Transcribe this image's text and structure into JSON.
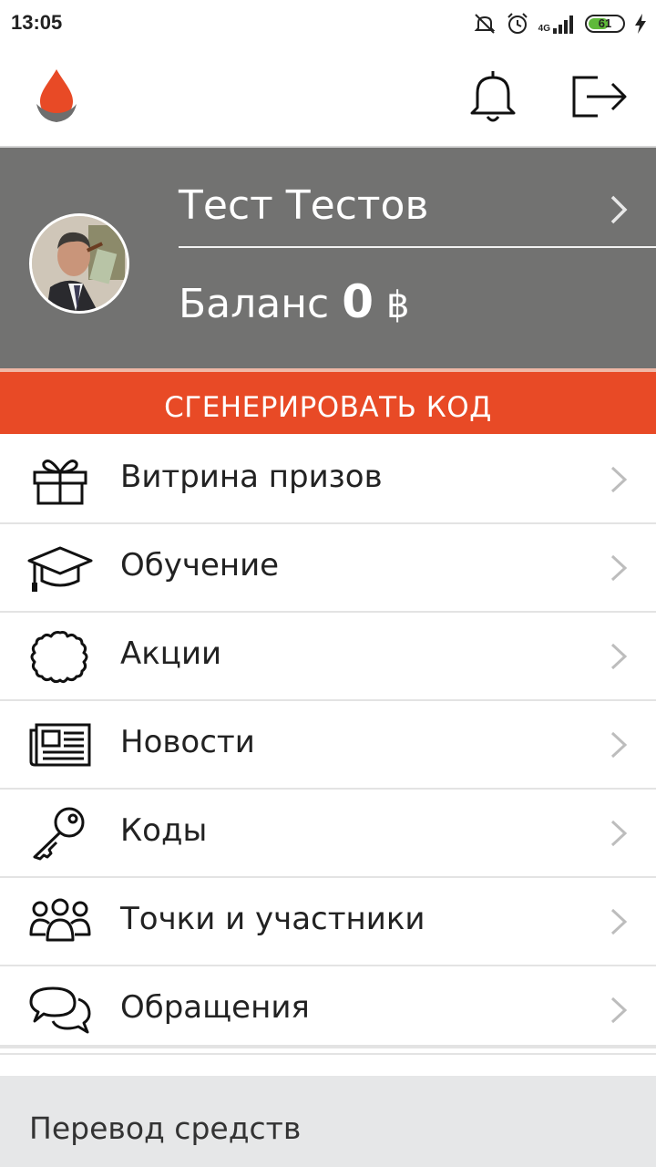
{
  "status": {
    "time": "13:05",
    "network": "4G",
    "battery": "61",
    "battery_level": 0.61
  },
  "header": {
    "logo_icon": "blood-drop-hand-icon",
    "notifications_icon": "bell-icon",
    "logout_icon": "logout-icon"
  },
  "profile": {
    "name": "Тест Тестов",
    "balance_label": "Баланс",
    "balance_value": "0",
    "currency": "฿"
  },
  "generate_button": "СГЕНЕРИРОВАТЬ КОД",
  "menu": {
    "items": [
      {
        "label": "Витрина призов",
        "icon": "gift-icon"
      },
      {
        "label": "Обучение",
        "icon": "graduation-cap-icon"
      },
      {
        "label": "Акции",
        "icon": "badge-icon"
      },
      {
        "label": "Новости",
        "icon": "newspaper-icon"
      },
      {
        "label": "Коды",
        "icon": "key-icon"
      },
      {
        "label": "Точки и участники",
        "icon": "users-icon"
      },
      {
        "label": "Обращения",
        "icon": "chat-bubbles-icon"
      }
    ]
  },
  "footer": {
    "transfer_label": "Перевод средств"
  },
  "colors": {
    "accent": "#e84a26",
    "panel": "#727271",
    "footer_bg": "#e6e7e8",
    "battery": "#5fb93a"
  }
}
